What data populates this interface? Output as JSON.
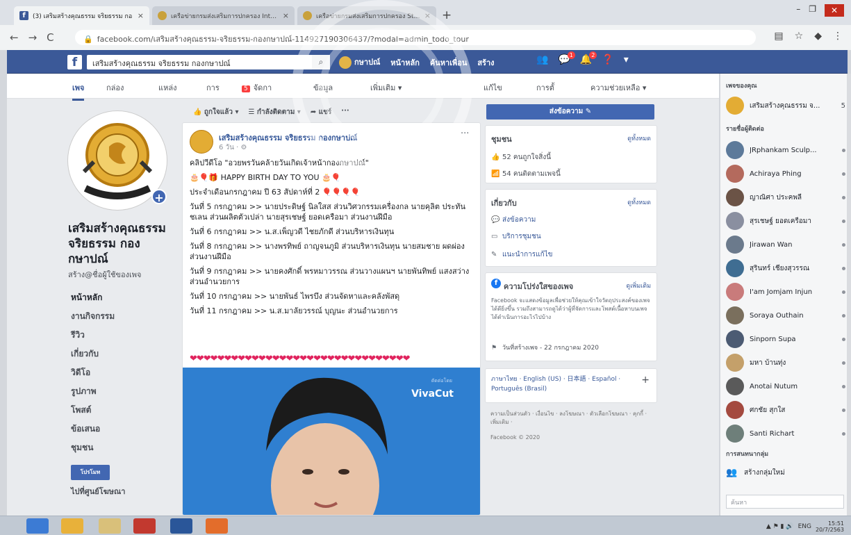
{
  "browser": {
    "tabs": [
      {
        "title": "(3) เสริมสร้างคุณธรรม จริยธรรม กอ",
        "close": "×"
      },
      {
        "title": "เครือข่ายกรมส่งเสริมการปกครอง Intranet",
        "close": "×"
      },
      {
        "title": "เครือข่ายกรมส่งเสริมการปกครอง Staff &",
        "close": "×"
      }
    ],
    "new_tab": "+",
    "window_controls": {
      "minimize": "–",
      "maximize": "❐",
      "close": "✕"
    },
    "nav": {
      "back": "←",
      "forward": "→",
      "reload": "C"
    },
    "url": "facebook.com/เสริมสร้างคุณธรรม-จริยธรรม-กองกษาปณ์-114927190306437/?modal=admin_todo_tour"
  },
  "fb_bar": {
    "logo": "f",
    "search_value": "เสริมสร้างคุณธรรม จริยธรรม กองกษาปณ์",
    "search_icon": "⌕",
    "nav_items": [
      "กษาปณ์",
      "หน้าหลัก",
      "ค้นหาเพื่อน",
      "สร้าง"
    ],
    "badges": {
      "messages": "1",
      "notifications": "2"
    }
  },
  "page_tabs": {
    "items": [
      "เพจ",
      "กล่อง",
      "แหล่ง",
      "การแจ้งเตือน",
      "ข้อมูล",
      "เพิ่มเติม ▾",
      "แก้ไข",
      "การตั้งค่า",
      "ความช่วยเหลือ ▾"
    ],
    "inbox_badge": "5",
    "short": [
      "เพจ",
      "กล่อง",
      "แหล่ง",
      "การ",
      "จัดกา",
      "ข้อมูล",
      "เพิ่มเติม ▾",
      "แก้ไข",
      "การตั้",
      "ความช่วยเหลือ ▾"
    ]
  },
  "left": {
    "page_name": "เสริมสร้างคุณธรรม จริยธรรม กองกษาปณ์",
    "handle": "สร้าง@ชื่อผู้ใช้ของเพจ",
    "nav": [
      "หน้าหลัก",
      "งานกิจกรรม",
      "รีวิว",
      "เกี่ยวกับ",
      "วิดีโอ",
      "รูปภาพ",
      "โพสต์",
      "ข้อเสนอ",
      "ชุมชน"
    ],
    "promote_label": "โปรโมท",
    "go_to_ad": "ไปที่ศูนย์โฆษณา"
  },
  "actions": {
    "like": "👍 ถูกใจแล้ว ▾",
    "follow": "☰ กำลังติดตาม ▾",
    "share": "➦ แชร์",
    "more": "···"
  },
  "post": {
    "author": "เสริมสร้างคุณธรรม จริยธรรม กองกษาปณ์",
    "time": "6 วัน · ⚙",
    "more": "···",
    "lines": [
      "คลิปวีดีโอ \"อวยพรวันคล้ายวันเกิดเจ้าหน้ากองกษาปณ์\"",
      "🎂🎈🎁 HAPPY BIRTH DAY TO YOU 🎂🎈",
      "ประจำเดือนกรกฎาคม ปี 63 สัปดาห์ที่ 2 🎈🎈🎈🎈",
      "วันที่ 5 กรกฎาคม >> นายประดิษฐ์ นิลใสส ส่วนวิศวกรรมเครื่องกล นายคุลิต ประทันชเลน ส่วนผลิตตัวเปล่า นายสุรเชษฐ์ ยอดเครือมา ส่วนงานฝีมือ",
      "วันที่ 6 กรกฎาคม >> น.ส.เพ็ญวดี ไชยภักดี ส่วนบริหารเงินทุน",
      "วันที่ 8 กรกฎาคม >> นางพรทิพย์ ถาญจนภูมิ ส่วนบริหารเงินทุน นายสมชาย ผดผ่อง ส่วนงานฝีมือ",
      "วันที่ 9 กรกฎาคม >> นายคงศักดิ์ พรหมาวรรณ ส่วนวางแผนฯ นายพันทิพย์ แสงสว่าง ส่วนอำนวยการ",
      "วันที่ 10 กรกฎาคม >> นายพันธ์ ไพรบึง ส่วนจัดหาและคลังพัสดุ",
      "วันที่ 11 กรกฎาคม >> น.ส.มาลัยวรรณ์ บุญนะ ส่วนอำนวยการ"
    ],
    "hearts": "❤❤❤❤❤❤❤❤❤❤❤❤❤❤❤❤❤❤❤❤❤❤❤❤❤❤❤❤❤❤❤❤",
    "video_brand": "VivaCut",
    "video_small": "ตัดต่อโดย"
  },
  "mid": {
    "send_message": "ส่งข้อความ ✎",
    "community": {
      "title": "ชุมชน",
      "see_all": "ดูทั้งหมด",
      "rows": [
        "52 คนถูกใจสิ่งนี้",
        "54 คนติดตามเพจนี้"
      ]
    },
    "about": {
      "title": "เกี่ยวกับ",
      "see_all": "ดูทั้งหมด",
      "rows": [
        "ส่งข้อความ",
        "บริการชุมชน",
        "แนะนำการแก้ไข"
      ]
    },
    "transparency": {
      "title": "ความโปร่งใสของเพจ",
      "see_more": "ดูเพิ่มเติม",
      "text": "Facebook จะแสดงข้อมูลเพื่อช่วยให้คุณเข้าใจวัตถุประสงค์ของเพจได้ดียิ่งขึ้น รวมถึงสามารถดูได้ว่าผู้ที่จัดการและโพสต์เนื้อหาบนเพจได้ดำเนินการอะไรไปบ้าง",
      "created": "วันที่สร้างเพจ - 22 กรกฎาคม 2020"
    },
    "languages": "ภาษาไทย · English (US) · 日本語 · Español · Português (Brasil)",
    "lang_plus": "+",
    "footer": [
      "ความเป็นส่วนตัว · เงื่อนไข · ลงโฆษณา · ตัวเลือกโฆษณา · คุกกี้ · เพิ่มเติม ·",
      "Facebook © 2020"
    ]
  },
  "right": {
    "your_pages": "เพจของคุณ",
    "my_page": {
      "name": "เสริมสร้างคุณธรรม จ...",
      "count": "5"
    },
    "contacts_title": "รายชื่อผู้ติดต่อ",
    "contacts": [
      "JRphankam Sculp...",
      "Achiraya Phing",
      "ญาณิศา ประคพลี",
      "สุรเชษฐ์ ยอดเครือมา",
      "Jirawan Wan",
      "สุรินทร์ เชียงสุวรรณ",
      "I'am Jomjam Injun",
      "Soraya Outhain",
      "Sinporn Supa",
      "มหา บ้านทุ่ง",
      "Anotai Nutum",
      "ศกชัย สุกใส",
      "Santi Richart"
    ],
    "contact_colors": [
      "#5d7a9a",
      "#b46a5d",
      "#6b5346",
      "#8a8fa0",
      "#6b7a8c",
      "#3f6d92",
      "#c97b7b",
      "#7a6f5d",
      "#4c5b73",
      "#c4a06a",
      "#5a5a5a",
      "#a44a3f",
      "#6e7f7a"
    ],
    "group_title": "การสนทนากลุ่ม",
    "create_group": "สร้างกลุ่มใหม่",
    "search_placeholder": "ค้นหา"
  },
  "taskbar": {
    "clock_time": "15:51",
    "clock_date": "20/7/2563",
    "lang": "ENG"
  },
  "colors": {
    "fb_blue": "#3b5998",
    "button_blue": "#4267b2",
    "badge_red": "#fa3e3e"
  }
}
